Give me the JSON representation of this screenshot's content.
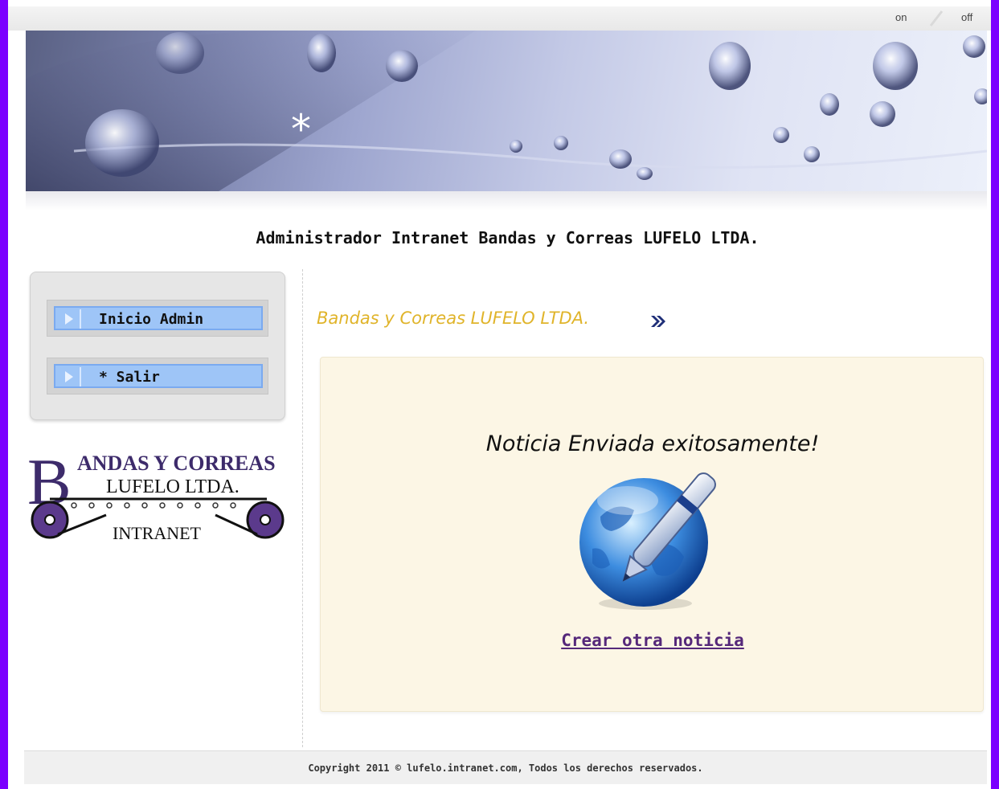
{
  "topbar": {
    "on_label": "on",
    "off_label": "off"
  },
  "site_title": "Administrador Intranet Bandas y Correas LUFELO LTDA.",
  "sidebar": {
    "items": [
      {
        "label": "Inicio Admin"
      },
      {
        "label": "* Salir"
      }
    ],
    "logo": {
      "line1": "ANDAS Y CORREAS",
      "initial": "B",
      "line2": "LUFELO LTDA.",
      "line3": "INTRANET"
    }
  },
  "main": {
    "section_title": "Bandas y Correas LUFELO LTDA.",
    "message": "Noticia Enviada exitosamente!",
    "create_link": "Crear otra noticia"
  },
  "footer": {
    "copyright": "Copyright 2011 © lufelo.intranet.com, Todos los derechos reservados."
  },
  "colors": {
    "side_border": "#7b00ff",
    "section_title": "#e0b42a",
    "menu_item": "#9ec5f7",
    "content_bg": "#fcf6e5",
    "link": "#55287a"
  }
}
